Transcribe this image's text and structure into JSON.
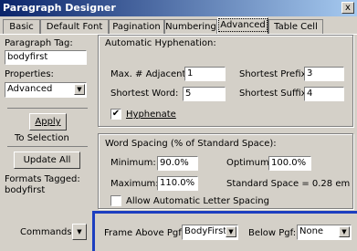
{
  "window": {
    "title": "Paragraph Designer",
    "close_label": "x"
  },
  "tabs": [
    {
      "label": "Basic"
    },
    {
      "label": "Default Font"
    },
    {
      "label": "Pagination"
    },
    {
      "label": "Numbering"
    },
    {
      "label": "Advanced"
    },
    {
      "label": "Table Cell"
    }
  ],
  "left": {
    "tag_label": "Paragraph Tag:",
    "tag_value": "bodyfirst",
    "properties_label": "Properties:",
    "properties_value": "Advanced",
    "apply_label": "Apply",
    "to_selection": "To Selection",
    "update_all_label": "Update All",
    "formats_tagged_label": "Formats Tagged:",
    "formats_tagged_value": "bodyfirst",
    "commands_label": "Commands:"
  },
  "hyphenation": {
    "title": "Automatic Hyphenation:",
    "max_adjacent_label": "Max. # Adjacent:",
    "max_adjacent_value": "1",
    "shortest_prefix_label": "Shortest Prefix:",
    "shortest_prefix_value": "3",
    "shortest_word_label": "Shortest Word:",
    "shortest_word_value": "5",
    "shortest_suffix_label": "Shortest Suffix:",
    "shortest_suffix_value": "4",
    "hyphenate_label": "Hyphenate",
    "hyphenate_checked": "✔"
  },
  "spacing": {
    "title": "Word Spacing (% of Standard Space):",
    "minimum_label": "Minimum:",
    "minimum_value": "90.0%",
    "optimum_label": "Optimum:",
    "optimum_value": "100.0%",
    "maximum_label": "Maximum:",
    "maximum_value": "110.0%",
    "standard_space": "Standard Space = 0.28 em",
    "letter_spacing_label": "Allow Automatic Letter Spacing"
  },
  "frames": {
    "above_label": "Frame Above Pgf:",
    "above_value": "BodyFirst",
    "below_label": "Below Pgf:",
    "below_value": "None"
  },
  "colors": {
    "accent": "#1c3ec0",
    "title_bar": "#0a246a"
  }
}
